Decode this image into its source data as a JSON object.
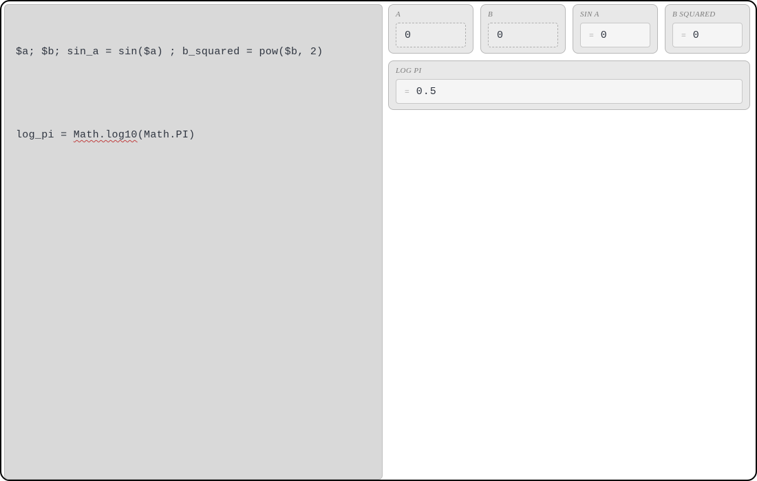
{
  "editor": {
    "line1": "$a; $b; sin_a = sin($a) ; b_squared = pow($b, 2)",
    "line2_prefix": "log_pi = ",
    "line2_underlined": "Math.log10",
    "line2_suffix": "(Math.PI)"
  },
  "cards": {
    "row1": [
      {
        "label": "A",
        "value": "0",
        "kind": "input"
      },
      {
        "label": "B",
        "value": "0",
        "kind": "input"
      },
      {
        "label": "SIN A",
        "value": "0",
        "kind": "output"
      },
      {
        "label": "B SQUARED",
        "value": "0",
        "kind": "output"
      }
    ],
    "row2": [
      {
        "label": "LOG PI",
        "value": "0.5",
        "kind": "output"
      }
    ]
  }
}
